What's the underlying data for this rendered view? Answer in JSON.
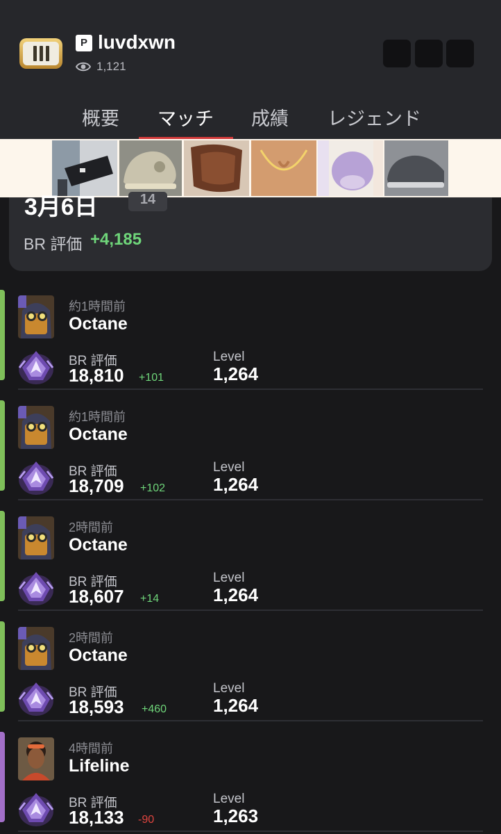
{
  "profile": {
    "platform_icon": "playstation-icon",
    "platform_glyph": "P",
    "username": "luvdxwn",
    "views": "1,121",
    "badge_icon": "gold-badge-icon"
  },
  "tabs": [
    {
      "label": "概要",
      "active": false
    },
    {
      "label": "マッチ",
      "active": true
    },
    {
      "label": "成績",
      "active": false
    },
    {
      "label": "レジェンド",
      "active": false
    }
  ],
  "colors": {
    "accent_green": "#7fbf5a",
    "accent_purple": "#a26fc8",
    "positive": "#6fd67a",
    "negative": "#e0453f",
    "tab_active": "#d23a3a"
  },
  "ad": {
    "images": [
      "ad-waist-bag-image",
      "ad-sneaker-image",
      "ad-hair-extension-image",
      "ad-gold-necklace-image",
      "ad-plush-puzzle-image",
      "ad-grey-sneaker-image"
    ]
  },
  "summary": {
    "date": "3月6日",
    "match_count": "14",
    "br_label": "BR 評価",
    "br_total": "+4,185"
  },
  "matches": [
    {
      "time": "約1時間前",
      "legend": "Octane",
      "br_label": "BR 評価",
      "br": "18,810",
      "delta": "+101",
      "level_label": "Level",
      "level": "1,264",
      "accent": "green"
    },
    {
      "time": "約1時間前",
      "legend": "Octane",
      "br_label": "BR 評価",
      "br": "18,709",
      "delta": "+102",
      "level_label": "Level",
      "level": "1,264",
      "accent": "green"
    },
    {
      "time": "2時間前",
      "legend": "Octane",
      "br_label": "BR 評価",
      "br": "18,607",
      "delta": "+14",
      "level_label": "Level",
      "level": "1,264",
      "accent": "green"
    },
    {
      "time": "2時間前",
      "legend": "Octane",
      "br_label": "BR 評価",
      "br": "18,593",
      "delta": "+460",
      "level_label": "Level",
      "level": "1,264",
      "accent": "green"
    },
    {
      "time": "4時間前",
      "legend": "Lifeline",
      "br_label": "BR 評価",
      "br": "18,133",
      "delta": "-90",
      "level_label": "Level",
      "level": "1,263",
      "accent": "purple"
    }
  ]
}
